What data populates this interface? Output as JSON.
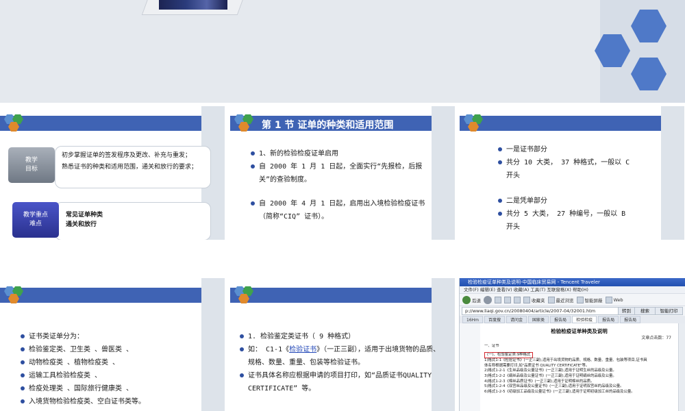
{
  "slide1": {
    "objective_label": "教学\n目标",
    "objective_text": [
      "初步掌握证单的签发程序及更改、补充与重发；",
      "熟悉证书的种类和适用范围，通关和放行的要求；"
    ],
    "key_label": "教学重点\n难点",
    "key_text": [
      "常见证单种类",
      "通关和放行"
    ]
  },
  "slide2": {
    "title": "第 1 节  证单的种类和适用范围",
    "bullets": [
      "1、新的检验检疫证单启用",
      "自 2000 年 1 月 1 日起，全面实行“先报检，后报关”的查验制度。",
      "自 2000 年 4 月 1 日起，启用出入境检验检疫证书（简称“CIQ” 证书）。"
    ]
  },
  "slide3": {
    "bullets": [
      "一是证书部分",
      "共分 10 大类， 37 种格式，一般以 C 开头",
      "二是凭单部分",
      "共分  5 大类， 27 种编号，一般以 B 开头"
    ]
  },
  "slide4": {
    "bullets": [
      "证书类证单分为：",
      "检验鉴定类、卫生类 、兽医类 、",
      "动物检疫类 、植物检疫类 、",
      "运输工具检验检疫类 、",
      "检疫处理类 、国际旅行健康类 、",
      "入境货物检验检疫类、空白证书类等。"
    ]
  },
  "slide5": {
    "bullets": [
      "1. 检验鉴定类证书（ 9 种格式）",
      "如： C1-1《检验证书》（一正三副），适用于出境货物的品质、规格、数量、重量、包装等检验证书。",
      "证书具体名称应根据申请的项目打印，如“品质证书QUALITY CERTIFICATE” 等。"
    ],
    "link_text": "检验证书"
  },
  "browser": {
    "title": "检验检疫证单种类及说明-中国临床贸易网 - Tencent Traveler",
    "menu": "文件(F)  编辑(E)  查看(V)  收藏(A)  工具(T)  互联窗格(X)  帮助(H)",
    "back": "后退",
    "favorites": "收藏夹",
    "history": "最近浏览",
    "smart": "智能屏蔽",
    "mail": "Web",
    "address": "p://www.liaqi.gov.cn/20080404/article/2007-04/32001.htm",
    "go": "转到",
    "search": "搜索",
    "print": "智能打印",
    "tabs": [
      "16Hm",
      "百度搜",
      "请问金",
      "国家类",
      "报告局",
      "检验检疫",
      "报告局",
      "报告局"
    ],
    "doc_title": "检验检疫证单种类及说明",
    "doc_count": "文章点击数：77",
    "section": "一、证书",
    "highlight": "(一)、检验鉴定类:9种格式",
    "lines": [
      "1)格式1-1《检验证书》(一正三副),适用于出境货物的品质、规格、数量、重量、包装等项目,证书具",
      "体名称根据需要打印,如\"品质证书 QUALITY CERTIFICATE\"等。",
      "2)格式1-2-1《生丝品级及公量证书》(一正三副),适用于证明生丝的品级及公量。",
      "3)格式1-2-2《绢丝品级及公量证书》(一正三副),适用于证明绢丝的品级及公量。",
      "4)格式1-2-3《棉丝品质证书》(一正三副),适用于证明棉丝的品质。",
      "5)格式1-2-4《双宫丝品级及公量证书》(一正三副),适用于证明双宫丝的品级及公量。",
      "6)格式1-2-5《初级加工品级及公量证书》(一正三副),适用于证明初级加工丝的品级及公量。"
    ]
  }
}
